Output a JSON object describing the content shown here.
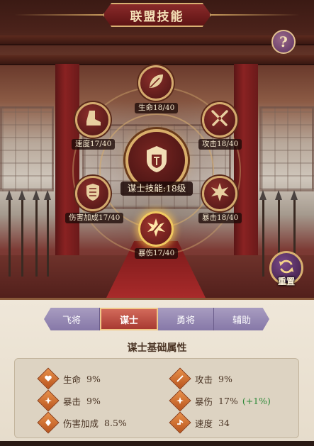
{
  "title": "联盟技能",
  "help_label": "?",
  "center_skill": {
    "label": "谋士技能:18级",
    "icon": "shield-helmet-icon"
  },
  "skills": [
    {
      "key": "life",
      "label": "生命18/40",
      "icon": "leaf-icon"
    },
    {
      "key": "speed",
      "label": "速度17/40",
      "icon": "boot-icon"
    },
    {
      "key": "attack",
      "label": "攻击18/40",
      "icon": "crossed-swords-icon"
    },
    {
      "key": "damage",
      "label": "伤害加成17/40",
      "icon": "armor-icon"
    },
    {
      "key": "crit",
      "label": "暴击18/40",
      "icon": "burst-icon"
    },
    {
      "key": "critdmg",
      "label": "暴伤17/40",
      "icon": "burst-sword-icon",
      "active": true
    }
  ],
  "reset_label": "重置",
  "tabs": [
    {
      "label": "飞将",
      "selected": false
    },
    {
      "label": "谋士",
      "selected": true
    },
    {
      "label": "勇将",
      "selected": false
    },
    {
      "label": "辅助",
      "selected": false
    }
  ],
  "section_title": "谋士基础属性",
  "stats": [
    {
      "name": "生命",
      "value": "9%",
      "bonus": ""
    },
    {
      "name": "攻击",
      "value": "9%",
      "bonus": ""
    },
    {
      "name": "暴击",
      "value": "9%",
      "bonus": ""
    },
    {
      "name": "暴伤",
      "value": "17%",
      "bonus": "(+1%)"
    },
    {
      "name": "伤害加成",
      "value": "8.5%",
      "bonus": ""
    },
    {
      "name": "速度",
      "value": "34",
      "bonus": ""
    }
  ],
  "colors": {
    "accent_gold": "#d4aa6e",
    "tab_selected": "#a83a32",
    "tab_normal": "#8678a8",
    "bonus_green": "#2f8a3a"
  }
}
